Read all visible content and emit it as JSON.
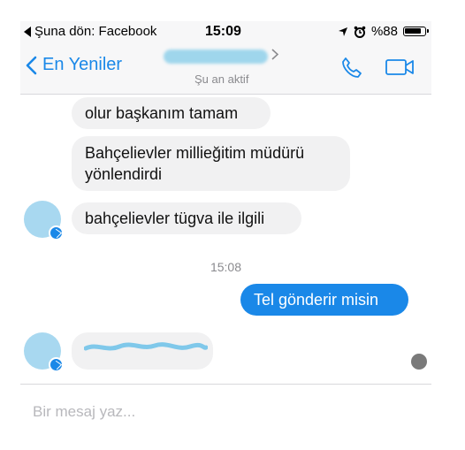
{
  "status_bar": {
    "back_app": "Şuna dön: Facebook",
    "time": "15:09",
    "battery_text": "%88",
    "battery_level": 0.88
  },
  "nav": {
    "back_label": "En Yeniler",
    "subtitle": "Şu an aktif",
    "icons": [
      "chevron-left-icon",
      "chevron-right-icon",
      "phone-icon",
      "video-camera-icon"
    ],
    "accent": "#1a88e8"
  },
  "messages": [
    {
      "from": "other",
      "text": "olur başkanım tamam"
    },
    {
      "from": "other",
      "text": "Bahçelievler millieğitim müdürü yönlendirdi"
    },
    {
      "from": "other",
      "text": "bahçelievler tügva ile ilgili"
    },
    {
      "from": "mine",
      "text": "Tel gönderir misin"
    }
  ],
  "timestamp": "15:08",
  "composer": {
    "placeholder": "Bir mesaj yaz..."
  },
  "colors": {
    "bubble_other": "#f1f1f2",
    "bubble_mine": "#1a88e8",
    "text_muted": "#8a8a8e"
  }
}
